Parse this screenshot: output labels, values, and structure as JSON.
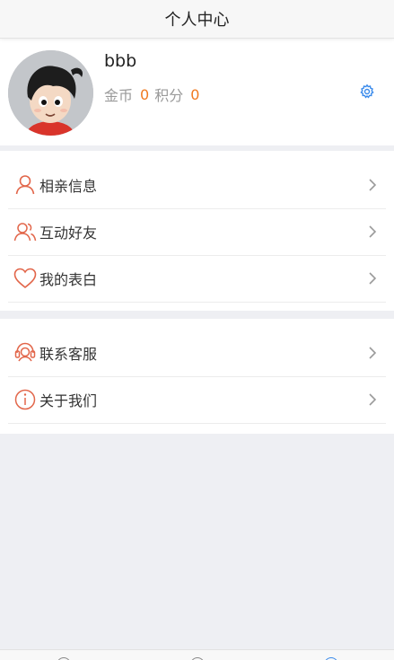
{
  "header": {
    "title": "个人中心"
  },
  "profile": {
    "username": "bbb",
    "coins_label": "金币",
    "coins_value": "0",
    "points_label": "积分",
    "points_value": "0"
  },
  "menu_group_1": [
    {
      "label": "相亲信息",
      "icon": "person-icon"
    },
    {
      "label": "互动好友",
      "icon": "friends-icon"
    },
    {
      "label": "我的表白",
      "icon": "heart-icon"
    }
  ],
  "menu_group_2": [
    {
      "label": "联系客服",
      "icon": "customer-service-icon"
    },
    {
      "label": "关于我们",
      "icon": "info-icon"
    }
  ],
  "colors": {
    "accent": "#e2664a",
    "number": "#f07a20",
    "gear": "#3b8beb"
  }
}
